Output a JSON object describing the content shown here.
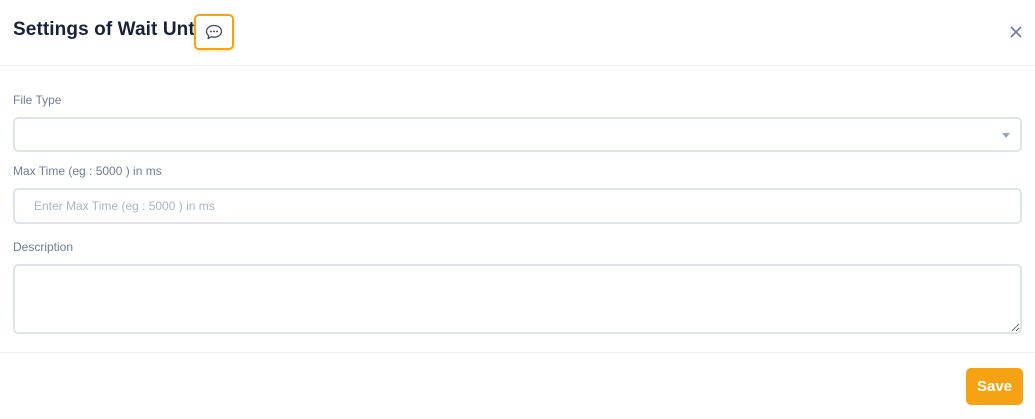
{
  "modal": {
    "title": "Settings of Wait Until",
    "icons": {
      "comment": "comment-icon",
      "close": "close-icon",
      "dropdown": "chevron-down-icon"
    }
  },
  "form": {
    "file_type": {
      "label": "File Type",
      "value": ""
    },
    "max_time": {
      "label": "Max Time (eg : 5000 ) in ms",
      "placeholder": "Enter Max Time (eg : 5000 ) in ms",
      "value": ""
    },
    "description": {
      "label": "Description",
      "value": ""
    }
  },
  "footer": {
    "save_label": "Save"
  },
  "colors": {
    "accent": "#f5a312",
    "title": "#17213a",
    "label": "#6f7f95",
    "border": "#dfe4ec"
  }
}
